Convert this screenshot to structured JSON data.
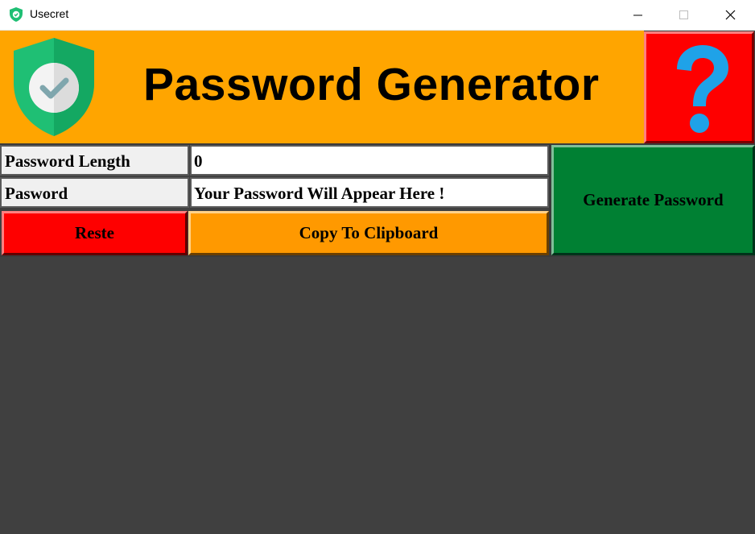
{
  "window": {
    "title": "Usecret",
    "icon": "shield-check-icon",
    "controls": [
      "minimize-icon",
      "maximize-icon",
      "close-icon"
    ]
  },
  "header": {
    "title": "Password Generator",
    "logo": "shield-check-icon",
    "help_icon": "question-mark-icon",
    "colors": {
      "banner": "#ffa500",
      "help_button": "#fe0000",
      "question_mark": "#1fa2e8"
    }
  },
  "form": {
    "length_label": "Password Length",
    "length_value": "0",
    "password_label": "Pasword",
    "password_value": "Your Password Will Appear Here !"
  },
  "buttons": {
    "reset_label": "Reste",
    "copy_label": "Copy To Clipboard",
    "generate_label": "Generate Password",
    "colors": {
      "reset": "#fe0000",
      "copy": "#ff9900",
      "generate": "#008033"
    }
  }
}
